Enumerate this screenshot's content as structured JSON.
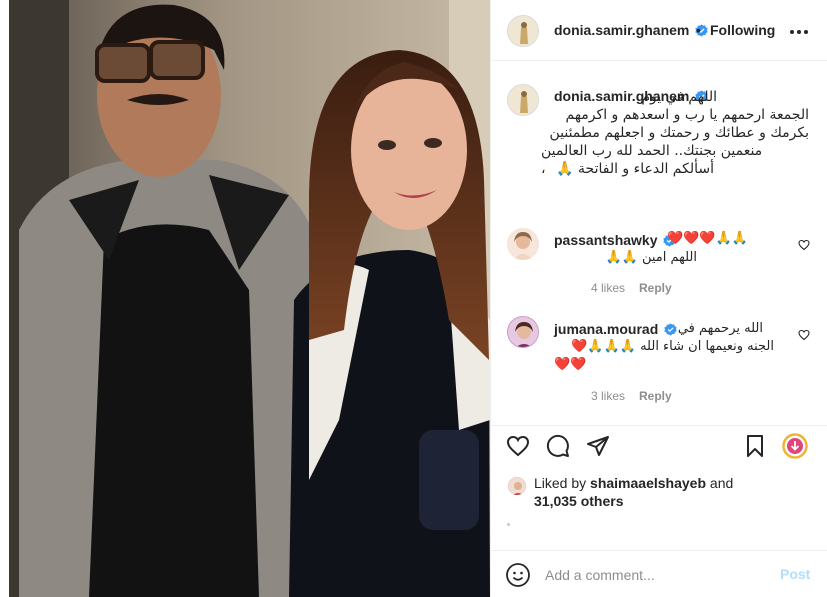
{
  "post": {
    "author": "donia.samir.ghanem",
    "follow_dot": "•",
    "follow_status": "Following",
    "more_icon": "more-horizontal-icon",
    "image_description_icon": "photo"
  },
  "caption": {
    "username": "donia.samir.ghanem",
    "lines": [
      "اللهم في يوم",
      "الجمعة ارحمهم يا رب و اسعدهم و اكرمهم",
      "بكرمك و عطائك و رحمتك و اجعلهم مطمئنين",
      "منعمين بجنتك.. الحمد لله رب العالمين ،",
      "أسألكم الدعاء و الفاتحة 🙏"
    ]
  },
  "comments": [
    {
      "username": "passantshawky",
      "verified": true,
      "line1": "❤️❤️❤️🙏🙏",
      "line2": "اللهم امين 🙏🙏",
      "likes": "4 likes",
      "reply": "Reply"
    },
    {
      "username": "jumana.mourad",
      "verified": true,
      "line1": "الله يرحمهم في",
      "line2": "الجنه ونعيمها ان شاء الله 🙏🙏🙏❤️",
      "line3": "❤️❤️",
      "likes": "3 likes",
      "reply": "Reply"
    }
  ],
  "actions": {
    "like_icon": "heart-icon",
    "comment_icon": "comment-icon",
    "share_icon": "share-icon",
    "save_icon": "bookmark-icon",
    "download_icon": "download-icon"
  },
  "likes": {
    "prefix": "Liked by",
    "user": "shaimaaelshayeb",
    "and": "and",
    "count": "31,035 others"
  },
  "composer": {
    "placeholder": "Add a comment...",
    "post_label": "Post",
    "emoji_icon": "emoji-icon"
  },
  "colors": {
    "verified": "#3897f0",
    "heart": "#ed4956",
    "post_disabled": "#b2dffc",
    "muted": "#8e8e8e",
    "download_ring": "#f0b336"
  }
}
